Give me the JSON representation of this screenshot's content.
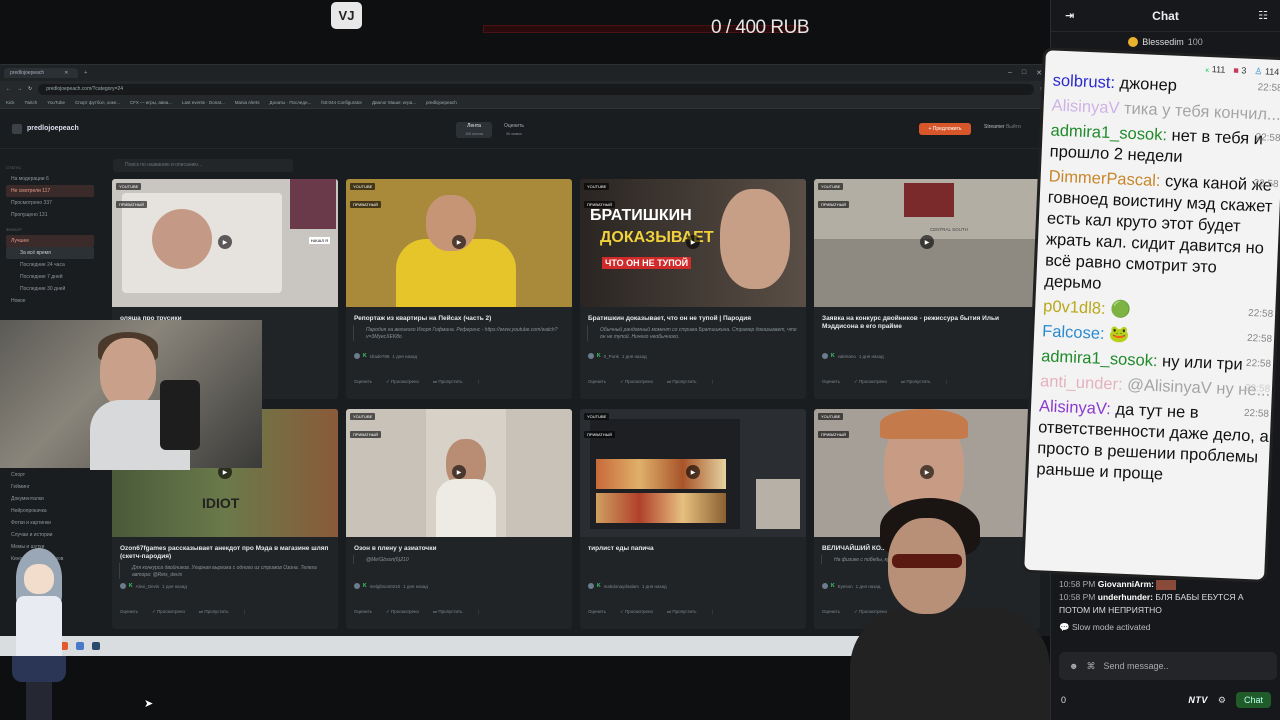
{
  "stream": {
    "logo_text": "VJ",
    "goal_text": "0 / 400 RUB"
  },
  "browser": {
    "tab_title": "predlojoepeach",
    "url": "predlojoepeach.com/?category=24",
    "bookmarks": [
      "Kick",
      "Twitch",
      "YouTube",
      "Спорт футбол, хоке...",
      "CFX — игры, авиа...",
      "Last events · Donat...",
      "Mania Alerts",
      "Донаты · Последн...",
      "fs0:044 Configurator",
      "Диалог Маше: игра...",
      "predlojoepeach"
    ]
  },
  "site": {
    "brand": "predlojoepeach",
    "nav_tabs": [
      {
        "label": "Лента",
        "sub": "105 постов"
      },
      {
        "label": "Оценить",
        "sub": "56 заявок"
      }
    ],
    "propose_label": "+ Предложить",
    "streamer_label": "Streamer",
    "logout_label": "Выйти",
    "search_placeholder": "Поиск по названию и описанию...",
    "sidebar": {
      "status_head": "СТАТУС",
      "status_items": [
        "На модерации 6",
        "Не смотрели 117",
        "Просмотрено 337",
        "Пропущено 131"
      ],
      "sort_head": "ФИЛЬТР",
      "best_label": "Лучшее",
      "time_items": [
        "За всё время",
        "Последние 24 часа",
        "Последние 7 дней",
        "Последние 30 дней"
      ],
      "new_label": "Новое",
      "category_items": [
        "Стримы и культура",
        "Спорт",
        "Гейминг",
        "Документалки",
        "Нейропрокачка",
        "Фотки и картинки",
        "Случаи и истории",
        "Мемы и шутки",
        "Кино, фильмы и доков"
      ]
    },
    "cards": [
      {
        "source": "YOUTUBE",
        "tag": "ПРИВАТНЫЙ",
        "title": "оляша про трусики",
        "desc": "",
        "author": "",
        "time": "",
        "actions": [
          "Оценить",
          "Просмотрено",
          "Пропустить"
        ],
        "thumb": "#c9c5c0"
      },
      {
        "source": "YOUTUBE",
        "tag": "ПРИВАТНЫЙ",
        "title": "Репортаж из квартиры на Пейсах (часть 2)",
        "desc": "Пародия на великого Игоря Гофмана. Референс - https://www.youtube.com/watch?v=3MyecXEK8o",
        "author": "shade788",
        "time": "1 дня назад",
        "actions": [
          "Оценить",
          "Просмотрено",
          "Пропустить"
        ],
        "thumb": "#a88a3a"
      },
      {
        "source": "YOUTUBE",
        "tag": "ПРИВАТНЫЙ",
        "title": "Братишкин доказывает, что он не тупой | Пародия",
        "desc": "Обычный рандомный момент со стрима Братишкина. Стример доказывает, что он не тупой. Ничего необычного.",
        "author": "0_Punk",
        "time": "1 дня назад",
        "actions": [
          "Оценить",
          "Просмотрено",
          "Пропустить"
        ],
        "thumb": "#3e3a36"
      },
      {
        "source": "YOUTUBE",
        "tag": "ПРИВАТНЫЙ",
        "title": "Заявка на конкурс двойников - режиссура бытия Ильи Мэддисона в его прайме",
        "desc": "",
        "author": "valeriano",
        "time": "1 дня назад",
        "actions": [
          "Оценить",
          "Просмотрено",
          "Пропустить"
        ],
        "thumb": "#b3aea4"
      },
      {
        "source": "YOUTUBE",
        "tag": "ПРИВАТНЫЙ",
        "title": "Ozon67fgames рассказывает анекдот про Мэда в магазине шляп (скетч-пародия)",
        "desc": "Для конкурса двойников. Угарная вырезка с одного из стримов Озона. Телега автора: @Reis_devis",
        "author": "Alexi_Devis",
        "time": "1 дня назад",
        "actions": [
          "Оценить",
          "Просмотрено",
          "Пропустить"
        ],
        "thumb": "#5a5d3a"
      },
      {
        "source": "YOUTUBE",
        "tag": "ПРИВАТНЫЙ",
        "title": "Озон в плену у азиаточки",
        "desc": "@Me!Gbson(6)210",
        "author": "melgibson0210",
        "time": "1 дня назад",
        "actions": [
          "Оценить",
          "Просмотрено",
          "Пропустить"
        ],
        "thumb": "#c8c2b8"
      },
      {
        "source": "YOUTUBE",
        "tag": "ПРИВАТНЫЙ",
        "title": "тирлист еды папича",
        "desc": "",
        "author": "makdonaydsalam",
        "time": "1 дня назад",
        "actions": [
          "Оценить",
          "Просмотрено",
          "Пропустить"
        ],
        "thumb": "#2a2d31"
      },
      {
        "source": "YOUTUBE",
        "tag": "ПРИВАТНЫЙ",
        "title": "ВЕЛИЧАЙШИЙ КО... ...аний",
        "desc": "На физике с победы, ку...",
        "author": "Eyeson",
        "time": "1 дня назад",
        "actions": [
          "Оценить",
          "Просмотрено",
          "Пропустить"
        ],
        "thumb": "#a59f97"
      }
    ],
    "thumb_texts": {
      "bratishkin_line1": "БРАТИШКИН",
      "bratishkin_line2": "ДОКАЗЫВАЕТ",
      "bratishkin_line3": "ЧТО ОН НЕ ТУПОЙ",
      "nachal": "НАЧАЛ Я",
      "idiot": "IDIOT",
      "central": "CENTRAL SOUTH"
    }
  },
  "chat": {
    "title": "Chat",
    "pinned_user": "Blessedim",
    "pinned_amount": "100",
    "overlay_stats": [
      "111",
      "3",
      "114"
    ],
    "overlay_messages": [
      {
        "nick": "solbrust:",
        "text": "джонер",
        "time": "22:58",
        "color": "#2a2ad0"
      },
      {
        "nick": "AlisinyaV",
        "text": "тика у тебя кончил...",
        "time": "",
        "color": "#8a3ad0",
        "faded": true
      },
      {
        "nick": "admira1_sosok:",
        "text": "нет в тебя и прошло 2 недели",
        "time": "22:58",
        "color": "#1f8a2a"
      },
      {
        "nick": "DimmerPascal:",
        "text": "сука каной же говноед воистину мэд скажет есть кал круто этот будет жрать кал. сидит давится но всё равно смотрит это дерьмо",
        "time": "22:58",
        "color": "#c8862a"
      },
      {
        "nick": "p0v1dl8:",
        "text": "🟢",
        "time": "22:58",
        "color": "#b9a81a"
      },
      {
        "nick": "Falcose:",
        "text": "🐸",
        "time": "22:58",
        "color": "#2a8ad0"
      },
      {
        "nick": "admira1_sosok:",
        "text": "ну или три",
        "time": "22:58",
        "color": "#1f8a2a"
      },
      {
        "nick": "anti_under:",
        "text": "@AlisinyaV ну не...",
        "time": "22:58",
        "color": "#c83a5a",
        "faded": true
      },
      {
        "nick": "AlisinyaV:",
        "text": "да тут не в ответственности даже дело, а просто в решении проблемы раньше и проще",
        "time": "22:58",
        "color": "#8a3ad0"
      }
    ],
    "lines": [
      {
        "time": "10:58 PM",
        "nick": "GiovanniArm:",
        "text": ""
      },
      {
        "time": "10:58 PM",
        "nick": "underhunder:",
        "text": "БЛЯ БАБЫ ЕБУТСЯ А ПОТОМ ИМ НЕПРИЯТНО"
      }
    ],
    "slow_mode": "Slow mode activated",
    "input_placeholder": "Send message..",
    "viewer_count": "0",
    "ntv_label": "NTV",
    "chat_button": "Chat"
  },
  "colors": {
    "accent": "#d8572a",
    "green": "#3bd46b",
    "chat_btn": "#1f5c2a"
  }
}
